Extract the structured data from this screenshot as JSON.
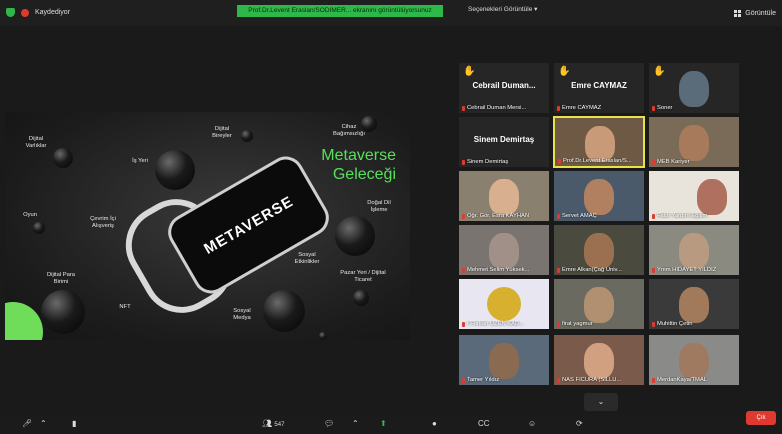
{
  "topbar": {
    "recording_label": "Kaydediyor",
    "banner": "Prof.Dr.Levent Eraslan/SODIMER... ekranını görüntülüyorsunuz",
    "speaker_view": "Seçenekleri Görüntüle",
    "view_label": "Görüntüle"
  },
  "slide": {
    "title_line1": "Metaverse",
    "title_line2": "Geleceği",
    "headset_text": "METAVERSE",
    "labels": {
      "dijital_varliklar": "Dijital Varlıklar",
      "is_yeri": "İş Yeri",
      "dijital_bireyler": "Dijital Bireyler",
      "cihaz": "Cihaz Bağımsızlığı",
      "oyun": "Oyun",
      "cevrimici": "Çevrim İçi Alışveriş",
      "dogal_dil": "Doğal Dil İşleme",
      "sosyal_etkinlikler": "Sosyal Etkinlikler",
      "dijital_para": "Dijital Para Birimi",
      "nft": "NFT",
      "sosyal_medya": "Sosyal Medya",
      "pazar": "Pazar Yeri / Dijital Ticaret"
    }
  },
  "participants": [
    {
      "name": "Cebrail Duman Mersi...",
      "big": "Cebrail  Duman...",
      "hand": true
    },
    {
      "name": "Emre CAYMAZ",
      "big": "Emre CAYMAZ",
      "hand": true
    },
    {
      "name": "Soner",
      "big": "",
      "hand": true
    },
    {
      "name": "Sinem Demirtaş",
      "big": "Sinem Demirtaş",
      "hand": false
    },
    {
      "name": "Prof.Dr.Levent Eraslan/S...",
      "big": "",
      "hand": false
    },
    {
      "name": "MEB Kariyer",
      "big": "",
      "hand": false
    },
    {
      "name": "Öğr. Gör. Esra KAYHAN",
      "big": "",
      "hand": false
    },
    {
      "name": "Servet AMAÇ",
      "big": "",
      "hand": false
    },
    {
      "name": "Fatih Yardım Eğitim",
      "big": "",
      "hand": false
    },
    {
      "name": "Mehmet Selim Yüksek...",
      "big": "",
      "hand": false
    },
    {
      "name": "Emre Alkan(Çağ Üniv...",
      "big": "",
      "hand": false
    },
    {
      "name": "Ymm HİDAYET YILDIZ",
      "big": "",
      "hand": false
    },
    {
      "name": "I Furkan ÜZEN KAD...",
      "big": "",
      "hand": false
    },
    {
      "name": "firat yagmur",
      "big": "",
      "hand": false
    },
    {
      "name": "Muhittin Çetin",
      "big": "",
      "hand": false
    },
    {
      "name": "Tamer Yıldız",
      "big": "",
      "hand": false
    },
    {
      "name": "NAS FİCURA (SİLLÜ...",
      "big": "",
      "hand": false
    },
    {
      "name": "MerdanKaya/TMAL",
      "big": "",
      "hand": false
    }
  ],
  "toolbar": {
    "participants_count": "547",
    "leave_label": "Çık"
  }
}
